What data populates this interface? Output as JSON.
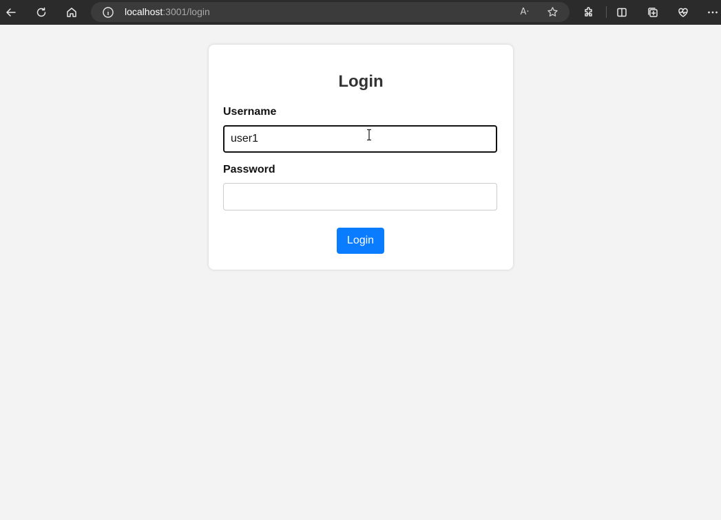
{
  "browser": {
    "url_host": "localhost",
    "url_path": ":3001/login",
    "read_aloud_label": "A·"
  },
  "login": {
    "title": "Login",
    "username_label": "Username",
    "username_value": "user1",
    "password_label": "Password",
    "password_value": "",
    "submit_label": "Login"
  },
  "colors": {
    "page_bg": "#f3f3f3",
    "toolbar_bg": "#2b2b2b",
    "button_bg": "#0a7cff"
  },
  "icons": [
    "back-arrow-icon",
    "refresh-icon",
    "home-icon",
    "info-icon",
    "read-aloud-icon",
    "favorite-star-icon",
    "extensions-icon",
    "split-screen-icon",
    "collections-icon",
    "browser-essentials-icon",
    "more-options-icon"
  ]
}
